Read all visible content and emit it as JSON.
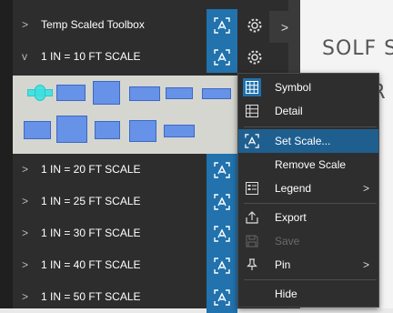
{
  "drawing": {
    "text": "SOLF SA\n\nSIFOR"
  },
  "panel": {
    "rows": [
      {
        "label": "Temp Scaled Toolbox",
        "chevron": ">"
      },
      {
        "label": "1 IN = 10 FT SCALE",
        "chevron": "v"
      },
      {
        "label": "1 IN = 20 FT SCALE",
        "chevron": ">"
      },
      {
        "label": "1 IN = 25 FT SCALE",
        "chevron": ">"
      },
      {
        "label": "1 IN = 30 FT SCALE",
        "chevron": ">"
      },
      {
        "label": "1 IN = 40 FT SCALE",
        "chevron": ">"
      },
      {
        "label": "1 IN = 50 FT SCALE",
        "chevron": ">"
      }
    ],
    "collapse_glyph": ">"
  },
  "menu": {
    "items": [
      {
        "label": "Symbol",
        "icon": "grid-icon"
      },
      {
        "label": "Detail",
        "icon": "list-icon"
      },
      {
        "label": "Set Scale...",
        "icon": "scale-icon",
        "active": true
      },
      {
        "label": "Remove Scale",
        "icon": ""
      },
      {
        "label": "Legend",
        "icon": "legend-icon",
        "submenu": ">"
      },
      {
        "label": "Export",
        "icon": "export-icon"
      },
      {
        "label": "Save",
        "icon": "save-icon",
        "disabled": true
      },
      {
        "label": "Pin",
        "icon": "pin-icon",
        "submenu": ">"
      },
      {
        "label": "Hide",
        "icon": ""
      }
    ]
  },
  "colors": {
    "accent": "#2172ad",
    "menu_active": "#1f5f90",
    "panel": "#2d2d2d"
  }
}
